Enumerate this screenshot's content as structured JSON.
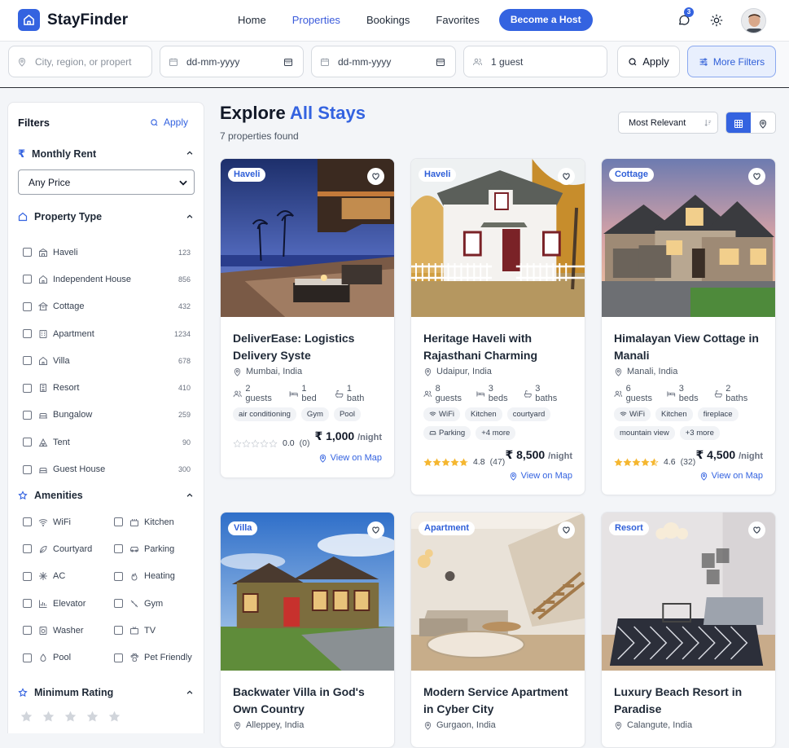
{
  "brand": {
    "name": "StayFinder"
  },
  "nav": {
    "links": [
      "Home",
      "Properties",
      "Bookings",
      "Favorites"
    ],
    "active": "Properties",
    "host_button": "Become a Host",
    "notification_count": "3"
  },
  "search": {
    "location_placeholder": "City, region, or propert",
    "checkin_placeholder": "dd-mm-yyyy",
    "checkout_placeholder": "dd-mm-yyyy",
    "guests_value": "1 guest",
    "apply_label": "Apply",
    "more_filters_label": "More Filters"
  },
  "sidebar": {
    "title": "Filters",
    "apply_label": "Apply",
    "rent": {
      "heading": "Monthly Rent",
      "selected": "Any Price"
    },
    "property_type": {
      "heading": "Property Type",
      "items": [
        {
          "label": "Haveli",
          "count": "123",
          "icon": "haveli-icon"
        },
        {
          "label": "Independent House",
          "count": "856",
          "icon": "house-icon"
        },
        {
          "label": "Cottage",
          "count": "432",
          "icon": "cottage-icon"
        },
        {
          "label": "Apartment",
          "count": "1234",
          "icon": "apartment-icon"
        },
        {
          "label": "Villa",
          "count": "678",
          "icon": "villa-icon"
        },
        {
          "label": "Resort",
          "count": "410",
          "icon": "resort-icon"
        },
        {
          "label": "Bungalow",
          "count": "259",
          "icon": "bungalow-icon"
        },
        {
          "label": "Tent",
          "count": "90",
          "icon": "tent-icon"
        },
        {
          "label": "Guest House",
          "count": "300",
          "icon": "guest-house-icon"
        }
      ]
    },
    "amenities": {
      "heading": "Amenities",
      "items": [
        {
          "label": "WiFi",
          "icon": "wifi-icon"
        },
        {
          "label": "Kitchen",
          "icon": "kitchen-icon"
        },
        {
          "label": "Courtyard",
          "icon": "leaf-icon"
        },
        {
          "label": "Parking",
          "icon": "car-icon"
        },
        {
          "label": "AC",
          "icon": "snowflake-icon"
        },
        {
          "label": "Heating",
          "icon": "flame-icon"
        },
        {
          "label": "Elevator",
          "icon": "elevator-icon"
        },
        {
          "label": "Gym",
          "icon": "dumbbell-icon"
        },
        {
          "label": "Washer",
          "icon": "washer-icon"
        },
        {
          "label": "TV",
          "icon": "tv-icon"
        },
        {
          "label": "Pool",
          "icon": "pool-icon"
        },
        {
          "label": "Pet Friendly",
          "icon": "paw-icon"
        }
      ]
    },
    "min_rating": {
      "heading": "Minimum Rating",
      "stars": 5
    }
  },
  "main": {
    "heading_prefix": "Explore",
    "heading_accent": "All Stays",
    "count_text": "7 properties found",
    "sort_selected": "Most Relevant",
    "active_view": "grid"
  },
  "properties": [
    {
      "tag": "Haveli",
      "title": "DeliverEase: Logistics Delivery Syste",
      "location": "Mumbai, India",
      "guests": "2 guests",
      "beds": "1 bed",
      "baths": "1 bath",
      "chips": [
        "air conditioning",
        "Gym",
        "Pool"
      ],
      "rating": "0.0",
      "reviews": "(0)",
      "rating_value": 0,
      "price": "₹ 1,000",
      "per": "/night",
      "map_label": "View on Map"
    },
    {
      "tag": "Haveli",
      "title": "Heritage Haveli with Rajasthani Charming",
      "location": "Udaipur, India",
      "guests": "8 guests",
      "beds": "3 beds",
      "baths": "3 baths",
      "chips": [
        "WiFi",
        "Kitchen",
        "courtyard",
        "Parking",
        "+4 more"
      ],
      "rating": "4.8",
      "reviews": "(47)",
      "rating_value": 4.8,
      "price": "₹ 8,500",
      "per": "/night",
      "map_label": "View on Map"
    },
    {
      "tag": "Cottage",
      "title": "Himalayan View Cottage in Manali",
      "location": "Manali, India",
      "guests": "6 guests",
      "beds": "3 beds",
      "baths": "2 baths",
      "chips": [
        "WiFi",
        "Kitchen",
        "fireplace",
        "mountain view",
        "+3 more"
      ],
      "rating": "4.6",
      "reviews": "(32)",
      "rating_value": 4.6,
      "price": "₹ 4,500",
      "per": "/night",
      "map_label": "View on Map"
    },
    {
      "tag": "Villa",
      "title": "Backwater Villa in God's Own Country",
      "location": "Alleppey, India"
    },
    {
      "tag": "Apartment",
      "title": "Modern Service Apartment in Cyber City",
      "location": "Gurgaon, India"
    },
    {
      "tag": "Resort",
      "title": "Luxury Beach Resort in Paradise",
      "location": "Calangute, India"
    }
  ],
  "colors": {
    "accent": "#3463e0",
    "star": "#f5b731"
  }
}
